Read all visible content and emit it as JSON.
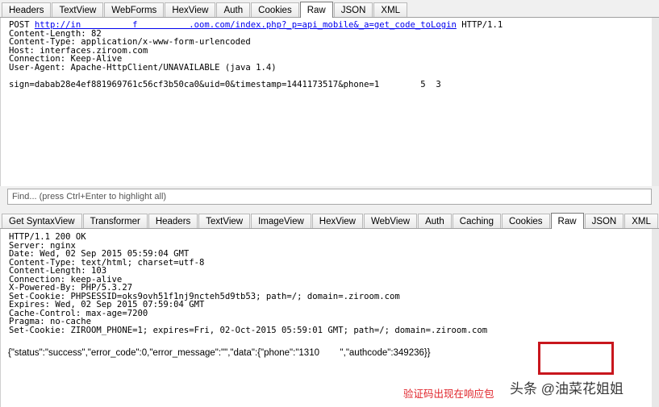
{
  "request": {
    "tabs": [
      "Headers",
      "TextView",
      "WebForms",
      "HexView",
      "Auth",
      "Cookies",
      "Raw",
      "JSON",
      "XML"
    ],
    "active_tab": "Raw",
    "line_method": "POST ",
    "line_url": "http://in          f          .oom.com/index.php?_p=api_mobile&_a=get_code_toLogin",
    "line_proto": " HTTP/1.1",
    "headers": [
      "Content-Length: 82",
      "Content-Type: application/x-www-form-urlencoded",
      "Host: interfaces.ziroom.com",
      "Connection: Keep-Alive",
      "User-Agent: Apache-HttpClient/UNAVAILABLE (java 1.4)"
    ],
    "body": "sign=dabab28e4ef881969761c56cf3b50ca0&uid=0&timestamp=1441173517&phone=1        5  3",
    "find_placeholder": "Find... (press Ctrl+Enter to highlight all)"
  },
  "response": {
    "tabs": [
      "Get SyntaxView",
      "Transformer",
      "Headers",
      "TextView",
      "ImageView",
      "HexView",
      "WebView",
      "Auth",
      "Caching",
      "Cookies",
      "Raw",
      "JSON",
      "XML"
    ],
    "active_tab": "Raw",
    "headers": [
      "HTTP/1.1 200 OK",
      "Server: nginx",
      "Date: Wed, 02 Sep 2015 05:59:04 GMT",
      "Content-Type: text/html; charset=utf-8",
      "Content-Length: 103",
      "Connection: keep-alive",
      "X-Powered-By: PHP/5.3.27",
      "Set-Cookie: PHPSESSID=oks9ovh51f1nj9ncteh5d9tb53; path=/; domain=.ziroom.com",
      "Expires: Wed, 02 Sep 2015 07:59:04 GMT",
      "Cache-Control: max-age=7200",
      "Pragma: no-cache",
      "Set-Cookie: ZIROOM_PHONE=1; expires=Fri, 02-Oct-2015 05:59:01 GMT; path=/; domain=.ziroom.com"
    ],
    "body": "{\"status\":\"success\",\"error_code\":0,\"error_message\":\"\",\"data\":{\"phone\":\"1310        \",\"authcode\":349236}}"
  },
  "annotation": "验证码出现在响应包",
  "watermark": "头条 @油菜花姐姐",
  "colors": {
    "highlight": "#c8161d",
    "annotation": "#e0242b"
  }
}
